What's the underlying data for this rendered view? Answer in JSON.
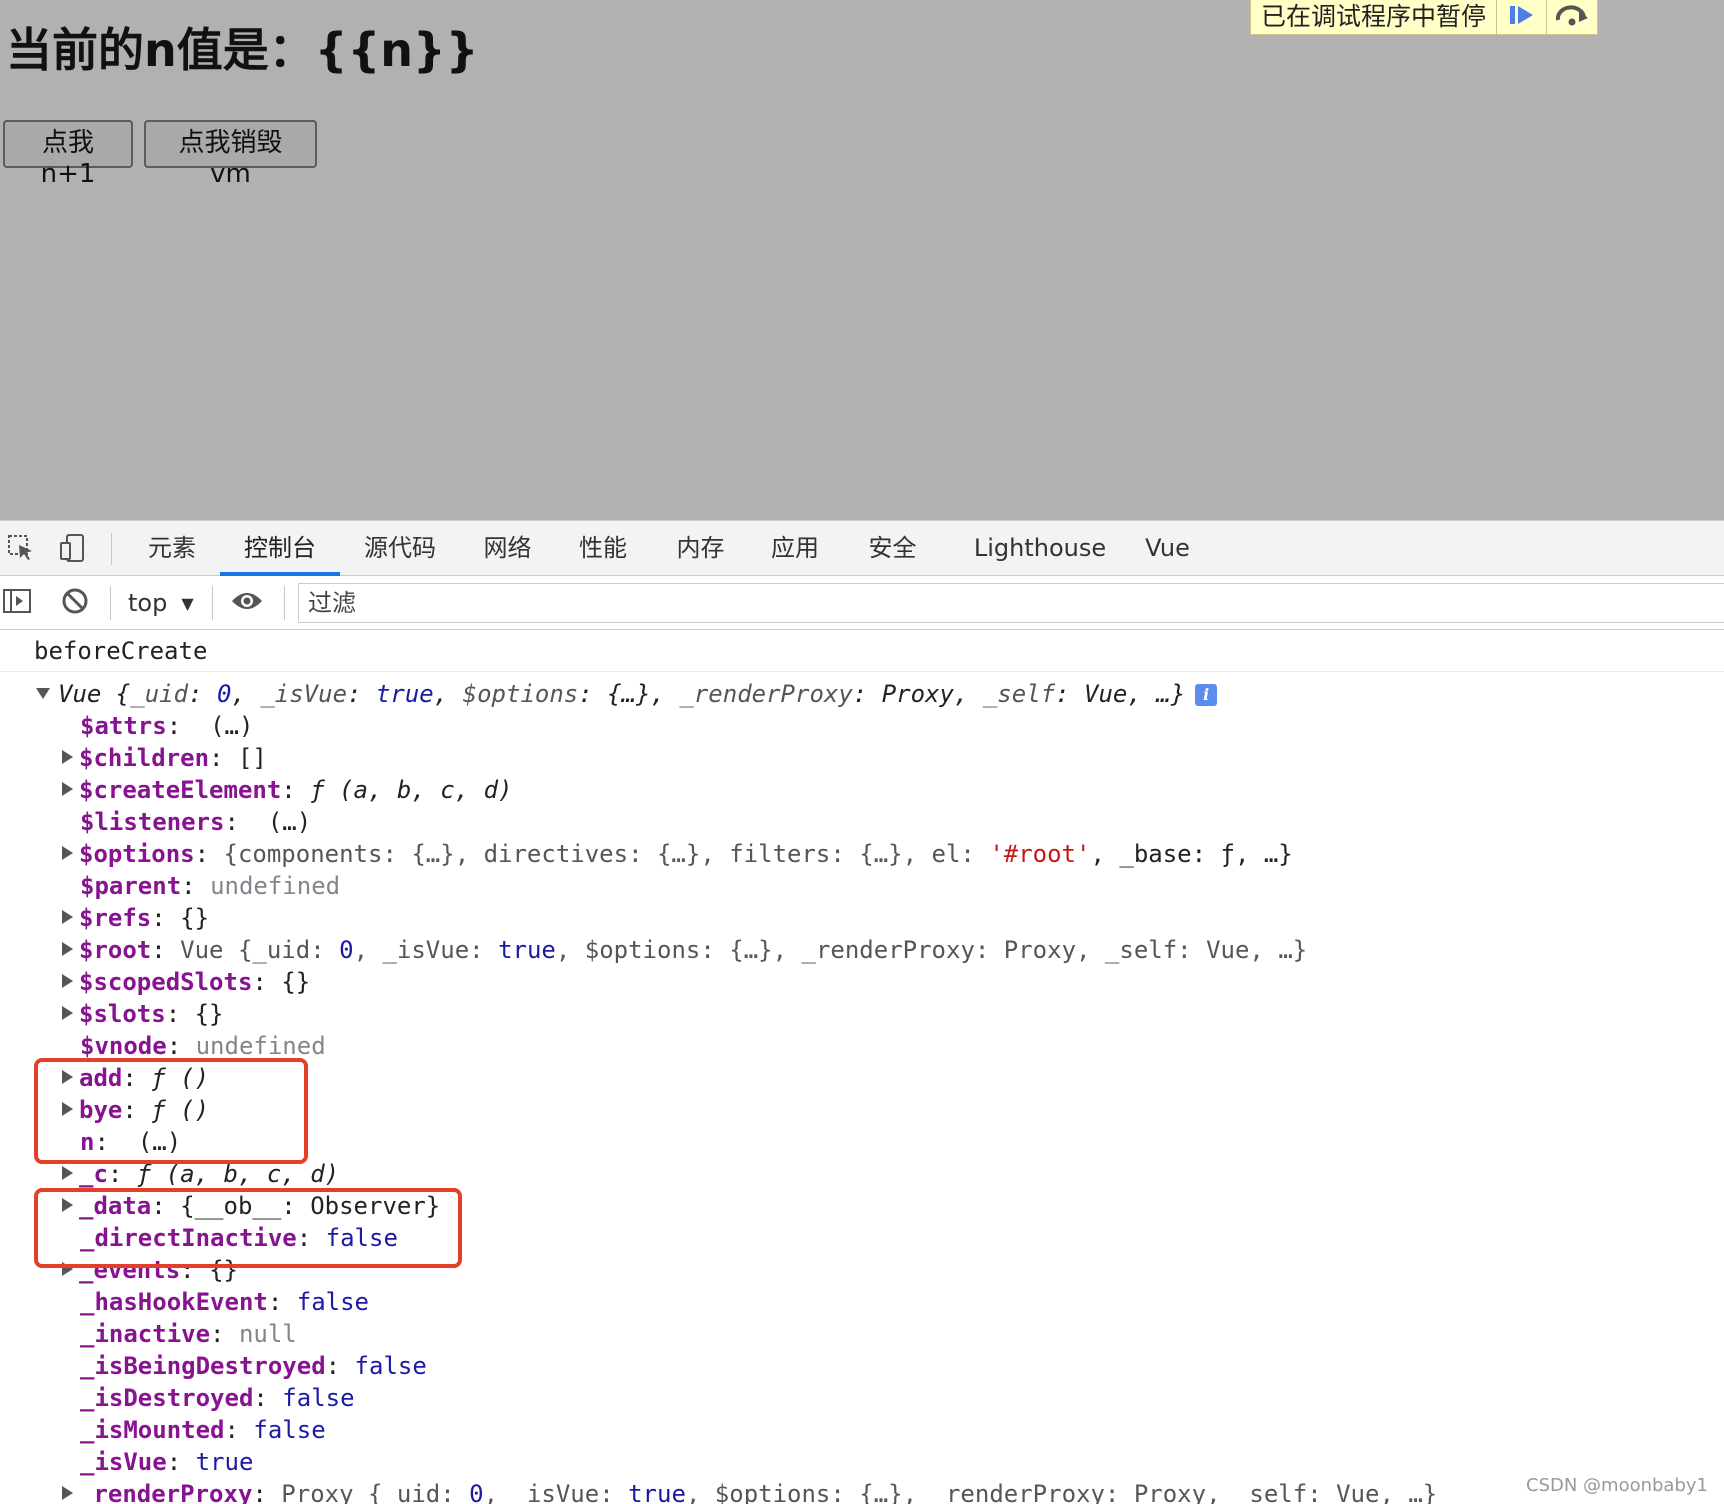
{
  "page": {
    "title": "当前的n值是：{{n}}",
    "buttons": {
      "add": "点我n+1",
      "destroy": "点我销毁vm"
    }
  },
  "debugger_overlay": {
    "text": "已在调试程序中暂停",
    "resume_icon": "resume-icon",
    "step_over_icon": "step-over-icon"
  },
  "devtools": {
    "tabs": [
      {
        "label": "元素",
        "active": false
      },
      {
        "label": "控制台",
        "active": true
      },
      {
        "label": "源代码",
        "active": false
      },
      {
        "label": "网络",
        "active": false
      },
      {
        "label": "性能",
        "active": false
      },
      {
        "label": "内存",
        "active": false
      },
      {
        "label": "应用",
        "active": false
      },
      {
        "label": "安全",
        "active": false
      },
      {
        "label": "Lighthouse",
        "active": false
      },
      {
        "label": "Vue",
        "active": false
      }
    ],
    "toolbar": {
      "context": "top",
      "filter_placeholder": "过滤"
    },
    "accent_color": "#1a73e8"
  },
  "console": {
    "message": "beforeCreate",
    "object_summary": {
      "ctor": "Vue",
      "open": " {",
      "k1": "_uid",
      "v1": "0",
      "k2": "_isVue",
      "v2": "true",
      "k3": "$options",
      "v3": "{…}",
      "k4": "_renderProxy",
      "v4": "Proxy",
      "k5": "_self",
      "v5": "Vue",
      "close": "…}",
      "info": "i"
    },
    "props": [
      {
        "key": "$attrs",
        "value": "(…)"
      },
      {
        "key": "$children",
        "value": "[]"
      },
      {
        "key": "$createElement",
        "value": "ƒ (a, b, c, d)"
      },
      {
        "key": "$listeners",
        "value": "(…)"
      },
      {
        "key": "$options",
        "value_parts": [
          "{components: {…}, directives: {…}, filters: {…}, el: ",
          "'#root'",
          ", _base: ƒ, …}"
        ]
      },
      {
        "key": "$parent",
        "value": "undefined"
      },
      {
        "key": "$refs",
        "value": "{}"
      },
      {
        "key": "$root",
        "value_parts": [
          "Vue {_uid: ",
          "0",
          ", _isVue: ",
          "true",
          ", $options: {…}, _renderProxy: Proxy, _self: Vue, …}"
        ]
      },
      {
        "key": "$scopedSlots",
        "value": "{}"
      },
      {
        "key": "$slots",
        "value": "{}"
      },
      {
        "key": "$vnode",
        "value": "undefined"
      },
      {
        "key": "add",
        "value": "ƒ ()"
      },
      {
        "key": "bye",
        "value": "ƒ ()"
      },
      {
        "key": "n",
        "value": "(…)"
      },
      {
        "key": "_c",
        "value": "ƒ (a, b, c, d)"
      },
      {
        "key": "_data",
        "value": "{__ob__: Observer}"
      },
      {
        "key": "_directInactive",
        "value": "false"
      },
      {
        "key": "_events",
        "value": "{}"
      },
      {
        "key": "_hasHookEvent",
        "value": "false"
      },
      {
        "key": "_inactive",
        "value": "null"
      },
      {
        "key": "_isBeingDestroyed",
        "value": "false"
      },
      {
        "key": "_isDestroyed",
        "value": "false"
      },
      {
        "key": "_isMounted",
        "value": "false"
      },
      {
        "key": "_isVue",
        "value": "true"
      },
      {
        "key": "_renderProxy",
        "value_parts": [
          "Proxy {_uid: ",
          "0",
          ", _isVue: ",
          "true",
          ", $options: {…}, _renderProxy: Proxy, _self: Vue, …}"
        ]
      }
    ],
    "highlight_color": "#e3402c"
  },
  "watermark": "CSDN @moonbaby1"
}
